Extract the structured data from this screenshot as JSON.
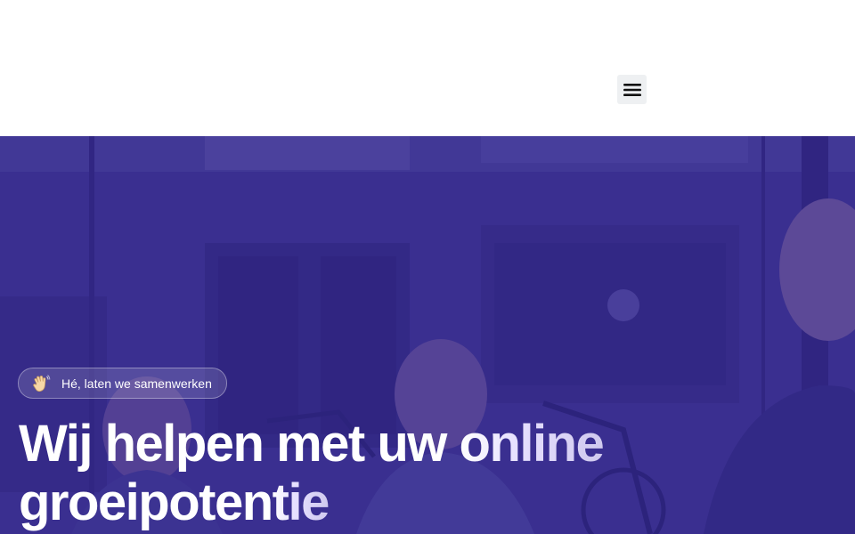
{
  "header": {
    "menu_icon": "hamburger-menu-icon"
  },
  "hero": {
    "greeting_icon": "waving-hand-icon",
    "greeting": "Hé, laten we samenwerken",
    "headline_line1_a": "Wij helpen met uw ",
    "headline_line1_b": "online",
    "headline_line2_a": "groeipoten",
    "headline_line2_b": "tie"
  }
}
